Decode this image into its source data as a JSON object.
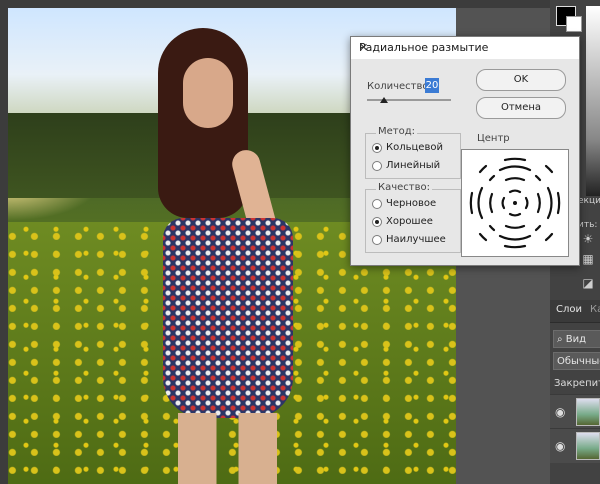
{
  "dialog": {
    "title": "Радиальное размытие",
    "close_glyph": "✕",
    "amount_label": "Количество",
    "amount_value": "20",
    "amount": 20,
    "amount_max": 100,
    "ok_label": "OK",
    "cancel_label": "Отмена",
    "method": {
      "title": "Метод:",
      "options": [
        {
          "label": "Кольцевой",
          "selected": true
        },
        {
          "label": "Линейный",
          "selected": false
        }
      ]
    },
    "quality": {
      "title": "Качество:",
      "options": [
        {
          "label": "Черновое",
          "selected": false
        },
        {
          "label": "Хорошее",
          "selected": true
        },
        {
          "label": "Наилучшее",
          "selected": false
        }
      ]
    },
    "center_label": "Центр"
  },
  "right_panel": {
    "tabs": [
      "Слои",
      "Ка"
    ],
    "kind_filter": "Вид",
    "blend_mode": "Обычные",
    "lock_label": "Закрепить:",
    "side_texts": [
      "екци",
      "ить:"
    ],
    "fg_color": "#000000",
    "bg_color": "#ffffff"
  }
}
